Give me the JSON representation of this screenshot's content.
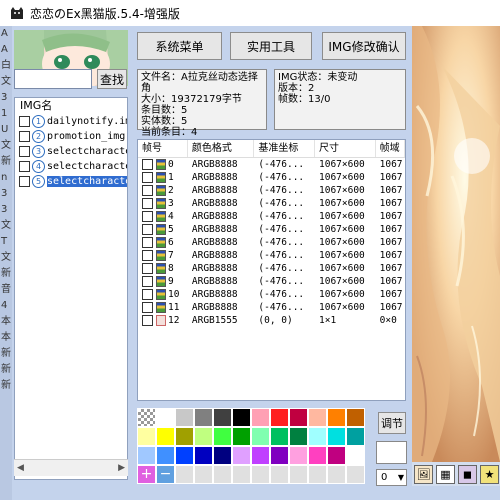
{
  "window": {
    "title": "恋恋のEx黑猫版.5.4-增强版"
  },
  "left_strip_chars": [
    "A",
    "A",
    "白",
    "文",
    "3",
    "1",
    "U",
    "文",
    "新",
    "n",
    "3",
    "3",
    "文",
    "T",
    "文",
    "新",
    "音",
    "4",
    "本",
    "本",
    "新",
    "新",
    "新"
  ],
  "search": {
    "value": "",
    "button_label": "查找"
  },
  "menu": {
    "system": "系统菜单",
    "tools": "实用工具",
    "img_confirm": "IMG修改确认"
  },
  "img_list": {
    "header": "IMG名",
    "items": [
      {
        "num": "1",
        "name": "dailynotify.img",
        "selected": false
      },
      {
        "num": "2",
        "name": "promotion_img.im",
        "selected": false
      },
      {
        "num": "3",
        "name": "selectcharacter.",
        "selected": false
      },
      {
        "num": "4",
        "name": "selectcharacter_",
        "selected": false
      },
      {
        "num": "5",
        "name": "selectcharacter",
        "selected": true
      }
    ]
  },
  "file_info": {
    "line1": "文件名：A拉克丝动态选择角",
    "line2": "大小：19372179字节",
    "line3": "条目数：5",
    "line4": "实体数：5",
    "line5": "当前条目：4"
  },
  "img_state": {
    "line1": "IMG状态：未变动",
    "line2": "版本：2",
    "line3": "帧数：13/0"
  },
  "frame_table": {
    "columns": [
      "帧号",
      "颜色格式",
      "基准坐标",
      "尺寸",
      "帧域"
    ],
    "rows": [
      {
        "id": "0",
        "format": "ARGB8888",
        "base": "(-476...",
        "size": "1067×600",
        "area": "1067",
        "alt": false
      },
      {
        "id": "1",
        "format": "ARGB8888",
        "base": "(-476...",
        "size": "1067×600",
        "area": "1067",
        "alt": false
      },
      {
        "id": "2",
        "format": "ARGB8888",
        "base": "(-476...",
        "size": "1067×600",
        "area": "1067",
        "alt": false
      },
      {
        "id": "3",
        "format": "ARGB8888",
        "base": "(-476...",
        "size": "1067×600",
        "area": "1067",
        "alt": false
      },
      {
        "id": "4",
        "format": "ARGB8888",
        "base": "(-476...",
        "size": "1067×600",
        "area": "1067",
        "alt": false
      },
      {
        "id": "5",
        "format": "ARGB8888",
        "base": "(-476...",
        "size": "1067×600",
        "area": "1067",
        "alt": false
      },
      {
        "id": "6",
        "format": "ARGB8888",
        "base": "(-476...",
        "size": "1067×600",
        "area": "1067",
        "alt": false
      },
      {
        "id": "7",
        "format": "ARGB8888",
        "base": "(-476...",
        "size": "1067×600",
        "area": "1067",
        "alt": false
      },
      {
        "id": "8",
        "format": "ARGB8888",
        "base": "(-476...",
        "size": "1067×600",
        "area": "1067",
        "alt": false
      },
      {
        "id": "9",
        "format": "ARGB8888",
        "base": "(-476...",
        "size": "1067×600",
        "area": "1067",
        "alt": false
      },
      {
        "id": "10",
        "format": "ARGB8888",
        "base": "(-476...",
        "size": "1067×600",
        "area": "1067",
        "alt": false
      },
      {
        "id": "11",
        "format": "ARGB8888",
        "base": "(-476...",
        "size": "1067×600",
        "area": "1067",
        "alt": false
      },
      {
        "id": "12",
        "format": "ARGB1555",
        "base": "(0, 0)",
        "size": "1×1",
        "area": "0×0",
        "alt": true
      }
    ]
  },
  "palette": {
    "colors": [
      "checker",
      "#ffffff",
      "#c8c8c8",
      "#808080",
      "#404040",
      "#000000",
      "#ffa0b4",
      "#ff2020",
      "#c00040",
      "#ffb8a0",
      "#ff8000",
      "#c06000",
      "#ffffa0",
      "#ffff00",
      "#a0a000",
      "#c0ff80",
      "#40ff40",
      "#00a000",
      "#80ffb0",
      "#00c060",
      "#008040",
      "#a0ffff",
      "#00e0e0",
      "#00a0a0",
      "#a0c8ff",
      "#4090ff",
      "#0040ff",
      "#0000c0",
      "#000080",
      "#e0a0ff",
      "#c040ff",
      "#8000c0",
      "#ffa0e0",
      "#ff40c0",
      "#c00080",
      "#ffffff",
      "plus",
      "minus",
      "#e0e0e0",
      "#e0e0e0",
      "#e0e0e0",
      "#e0e0e0",
      "#e0e0e0",
      "#e0e0e0",
      "#e0e0e0",
      "#e0e0e0",
      "#e0e0e0",
      "#e0e0e0"
    ]
  },
  "adjust": {
    "label": "调节",
    "select_value": "0"
  }
}
